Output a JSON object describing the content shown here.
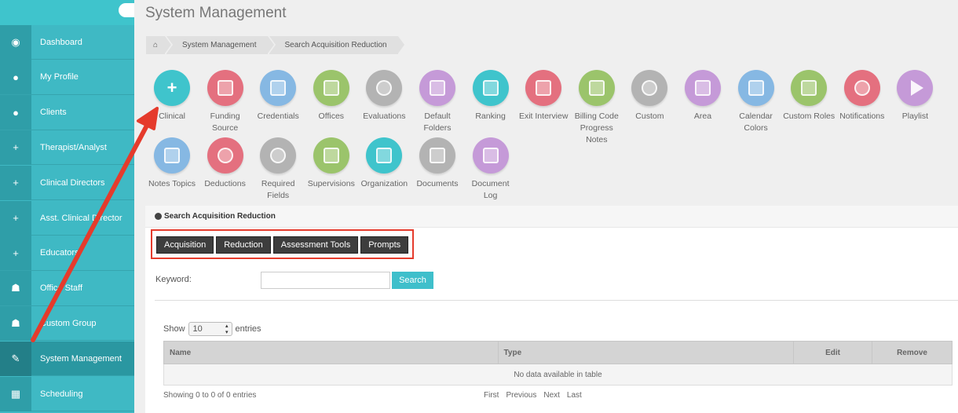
{
  "sidebar": {
    "items": [
      {
        "label": "Dashboard",
        "icon": "dashboard-icon",
        "glyph": "◉"
      },
      {
        "label": "My Profile",
        "icon": "user-icon",
        "glyph": "●"
      },
      {
        "label": "Clients",
        "icon": "user-icon",
        "glyph": "●"
      },
      {
        "label": "Therapist/Analyst",
        "icon": "plus-icon",
        "glyph": "+"
      },
      {
        "label": "Clinical Directors",
        "icon": "plus-icon",
        "glyph": "+"
      },
      {
        "label": "Asst. Clinical Director",
        "icon": "plus-icon",
        "glyph": "+"
      },
      {
        "label": "Educators",
        "icon": "plus-icon",
        "glyph": "+"
      },
      {
        "label": "Office Staff",
        "icon": "group-icon",
        "glyph": "☗"
      },
      {
        "label": "Custom Group",
        "icon": "group-icon",
        "glyph": "☗"
      },
      {
        "label": "System Management",
        "icon": "wrench-icon",
        "glyph": "✎"
      },
      {
        "label": "Scheduling",
        "icon": "calendar-icon",
        "glyph": "▦"
      }
    ]
  },
  "page_title": "System Management",
  "breadcrumb": {
    "home_icon": "home-icon",
    "items": [
      "System Management",
      "Search Acquisition Reduction"
    ]
  },
  "modules": [
    {
      "label": "Clinical",
      "color": "#3fc4cc",
      "icon": "plus-icon"
    },
    {
      "label": "Funding Source",
      "color": "#e4707f",
      "icon": "book-icon"
    },
    {
      "label": "Credentials",
      "color": "#86b8e3",
      "icon": "book-icon"
    },
    {
      "label": "Offices",
      "color": "#9bc46b",
      "icon": "building-icon"
    },
    {
      "label": "Evaluations",
      "color": "#b3b3b3",
      "icon": "gear-icon"
    },
    {
      "label": "Default Folders",
      "color": "#c59ad8",
      "icon": "folder-icon"
    },
    {
      "label": "Ranking",
      "color": "#3fc4cc",
      "icon": "bar-chart-icon"
    },
    {
      "label": "Exit Interview",
      "color": "#e4707f",
      "icon": "checkbox-icon"
    },
    {
      "label": "Billing Code Progress Notes",
      "color": "#9bc46b",
      "icon": "book-icon"
    },
    {
      "label": "Custom",
      "color": "#b3b3b3",
      "icon": "gear-icon"
    },
    {
      "label": "Area",
      "color": "#c59ad8",
      "icon": "building-icon"
    },
    {
      "label": "Calendar Colors",
      "color": "#86b8e3",
      "icon": "calendar-icon"
    },
    {
      "label": "Custom Roles",
      "color": "#9bc46b",
      "icon": "group-icon"
    },
    {
      "label": "Notifications",
      "color": "#e4707f",
      "icon": "bell-icon"
    },
    {
      "label": "Playlist",
      "color": "#c59ad8",
      "icon": "play-icon"
    },
    {
      "label": "Notes Topics",
      "color": "#86b8e3",
      "icon": "list-icon"
    },
    {
      "label": "Deductions",
      "color": "#e4707f",
      "icon": "minus-circle-icon"
    },
    {
      "label": "Required Fields",
      "color": "#b3b3b3",
      "icon": "exclamation-icon"
    },
    {
      "label": "Supervisions",
      "color": "#9bc46b",
      "icon": "sitemap-icon"
    },
    {
      "label": "Organization",
      "color": "#3fc4cc",
      "icon": "hospital-icon"
    },
    {
      "label": "Documents",
      "color": "#b3b3b3",
      "icon": "list-icon"
    },
    {
      "label": "Document Log",
      "color": "#c59ad8",
      "icon": "indent-icon"
    }
  ],
  "panel": {
    "title": "Search Acquisition Reduction",
    "title_icon": "globe-icon",
    "tabs": [
      "Acquisition",
      "Reduction",
      "Assessment Tools",
      "Prompts"
    ],
    "keyword_label": "Keyword:",
    "keyword_value": "",
    "search_label": "Search",
    "show_label": "Show",
    "entries_value": "10",
    "entries_label": "entries",
    "columns": [
      "Name",
      "Type",
      "Edit",
      "Remove"
    ],
    "empty_message": "No data available in table",
    "info_text": "Showing 0 to 0 of 0 entries",
    "pager": [
      "First",
      "Previous",
      "Next",
      "Last"
    ]
  },
  "colors": {
    "sidebar": "#3fb9c4",
    "accent": "#3fc4cc",
    "annotation": "#e53b2c"
  }
}
